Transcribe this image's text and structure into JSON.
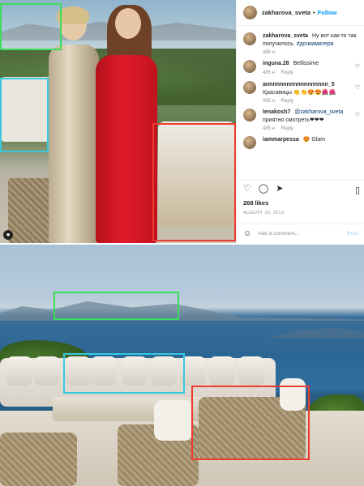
{
  "post": {
    "username": "zakharova_sveta",
    "separator": "•",
    "follow_label": "Follow",
    "caption": {
      "username": "zakharova_sveta",
      "text": "Ну вот как-то так получилось.",
      "hashtag": "#дочкиматери",
      "time": "485 н"
    },
    "comments": [
      {
        "username": "inguna.28",
        "text": "Bellissime",
        "time": "485 н",
        "reply": "Reply"
      },
      {
        "username": "annnnnnnnnnnnnnnnnn_5",
        "text": "Красавицы 👏👏😍😍🌺🌺",
        "time": "485 н",
        "reply": "Reply"
      },
      {
        "username": "lenakosh7",
        "mention": "@zakharova_sveta",
        "text": "приятно смотреть❤❤❤",
        "time": "485 н",
        "reply": "Reply"
      },
      {
        "username": "iammarpessa",
        "text": "😍 Glam",
        "time": "",
        "reply": ""
      }
    ],
    "actions": {
      "like_icon": "heart-icon",
      "comment_icon": "comment-icon",
      "share_icon": "share-icon",
      "save_icon": "bookmark-icon"
    },
    "likes": "268 likes",
    "date": "AUGUST 19, 2013",
    "add_comment_placeholder": "Add a comment...",
    "post_button": "Post"
  },
  "annotation_colors": {
    "green": "#3ddc5a",
    "cyan": "#38c8e0",
    "red": "#ee3b2f"
  }
}
